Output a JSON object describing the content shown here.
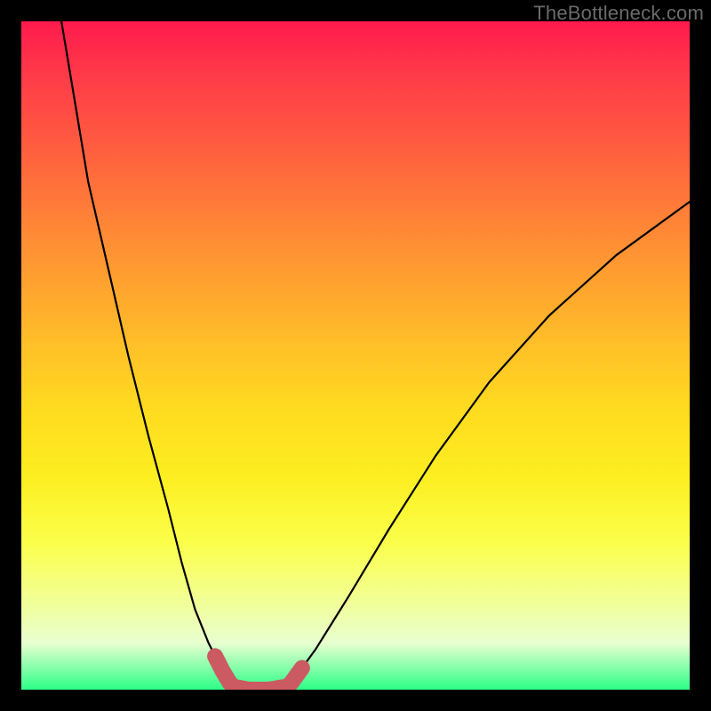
{
  "watermark": "TheBottleneck.com",
  "colors": {
    "frame_bg_top": "#ff1a4d",
    "frame_bg_bottom": "#2dff88",
    "curve": "#000000",
    "marker": "#cb5a62",
    "page_bg": "#000000",
    "watermark_text": "#6a6a6a"
  },
  "chart_data": {
    "type": "line",
    "title": "",
    "xlabel": "",
    "ylabel": "",
    "xlim": [
      0,
      100
    ],
    "ylim": [
      0,
      100
    ],
    "grid": false,
    "series": [
      {
        "name": "left-branch",
        "x": [
          6,
          8,
          10,
          13,
          16,
          19,
          22,
          24,
          26,
          28,
          30,
          31.5
        ],
        "y": [
          100,
          88,
          76,
          63,
          50,
          38,
          27,
          19,
          12,
          7,
          3,
          0.5
        ]
      },
      {
        "name": "valley-floor",
        "x": [
          31.5,
          34,
          37,
          40
        ],
        "y": [
          0.5,
          0,
          0,
          0.5
        ]
      },
      {
        "name": "right-branch",
        "x": [
          40,
          44,
          49,
          55,
          62,
          70,
          79,
          89,
          100
        ],
        "y": [
          0.5,
          6,
          14,
          24,
          35,
          46,
          56,
          65,
          73
        ]
      }
    ],
    "annotations": {
      "highlight_range_x": [
        29,
        42
      ],
      "highlight_dot_x": 29,
      "highlight_dot_y": 5
    },
    "legend": false
  }
}
